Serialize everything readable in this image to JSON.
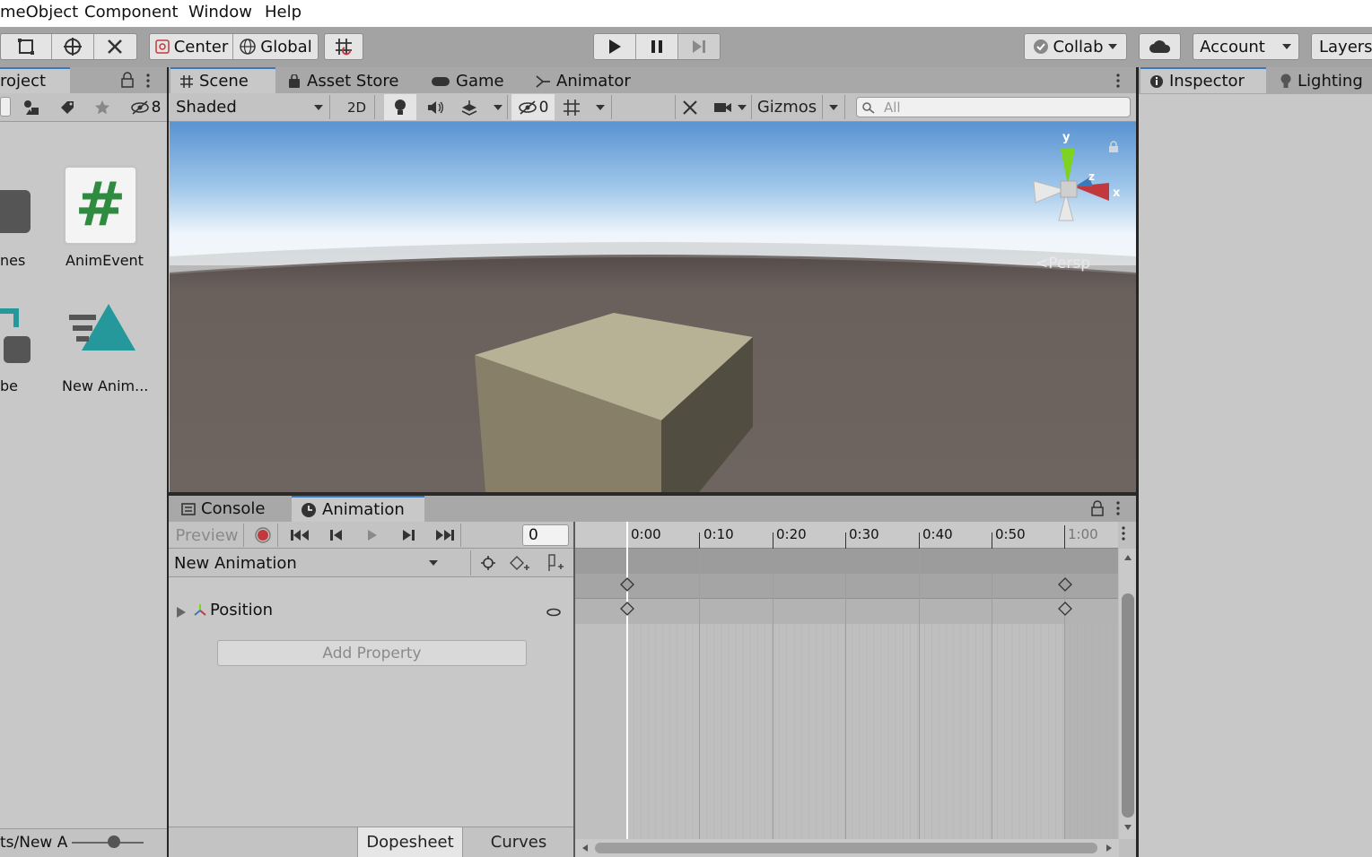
{
  "menu": [
    "meObject",
    "Component",
    "Window",
    "Help"
  ],
  "toolbar": {
    "pivot_label": "Center",
    "space_label": "Global",
    "collab_label": "Collab",
    "account_label": "Account",
    "layers_label": "Layers"
  },
  "project": {
    "tab_label": "roject",
    "hidden_count": "8",
    "assets": [
      {
        "name": "nes",
        "icon": "folder-icon"
      },
      {
        "name": "AnimEvent",
        "icon": "csharp-script-icon"
      },
      {
        "name": "be",
        "icon": "prefab-icon"
      },
      {
        "name": "New Anim...",
        "icon": "animation-clip-icon"
      }
    ],
    "path": "ts/New A"
  },
  "scene": {
    "tabs": [
      "Scene",
      "Asset Store",
      "Game",
      "Animator"
    ],
    "draw_mode": "Shaded",
    "toggle_2d": "2D",
    "hidden_count": "0",
    "gizmos_label": "Gizmos",
    "search_placeholder": "All",
    "persp_label": "<Persp",
    "axis_labels": {
      "y": "y",
      "x": "x",
      "z": "z"
    }
  },
  "animation": {
    "tabs": [
      "Console",
      "Animation"
    ],
    "preview_label": "Preview",
    "frame_value": "0",
    "clip_name": "New Animation",
    "property_label": "Position",
    "add_property_label": "Add Property",
    "time_ticks": [
      "0:00",
      "0:10",
      "0:20",
      "0:30",
      "0:40",
      "0:50",
      "1:00"
    ],
    "keyframe_times": [
      "0:00",
      "1:00"
    ],
    "mode_tabs": [
      "Dopesheet",
      "Curves"
    ]
  },
  "inspector": {
    "tabs": [
      "Inspector",
      "Lighting"
    ]
  },
  "colors": {
    "accent": "#3a79bb",
    "record": "#c2393d",
    "script_green": "#2e8b3f",
    "anim_teal": "#24989b",
    "scene_ground": "#6d6460",
    "cube_top": "#b7b195"
  }
}
